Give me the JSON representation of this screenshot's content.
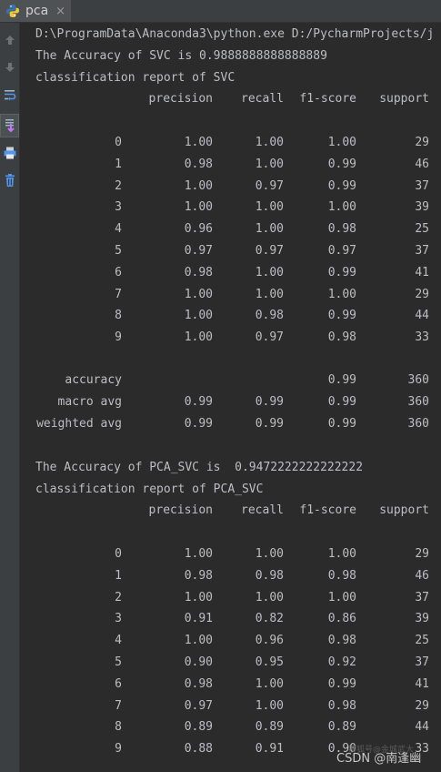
{
  "tab": {
    "title": "pca",
    "close": "×"
  },
  "sidebar": {
    "icons": [
      "up-arrow-icon",
      "down-arrow-icon",
      "soft-wrap-icon",
      "scroll-to-end-icon",
      "print-icon",
      "trash-icon"
    ]
  },
  "console": {
    "command_line": "D:\\ProgramData\\Anaconda3\\python.exe D:/PycharmProjects/j",
    "svc_accuracy_line": "The Accuracy of SVC is 0.9888888888888889",
    "svc_report_title": "classification report of SVC",
    "pca_accuracy_line": "The Accuracy of PCA_SVC is  0.9472222222222222",
    "pca_report_title": "classification report of PCA_SVC"
  },
  "report_columns": [
    "precision",
    "recall",
    "f1-score",
    "support"
  ],
  "svc_report": {
    "rows": [
      {
        "label": "0",
        "precision": "1.00",
        "recall": "1.00",
        "f1": "1.00",
        "support": "29"
      },
      {
        "label": "1",
        "precision": "0.98",
        "recall": "1.00",
        "f1": "0.99",
        "support": "46"
      },
      {
        "label": "2",
        "precision": "1.00",
        "recall": "0.97",
        "f1": "0.99",
        "support": "37"
      },
      {
        "label": "3",
        "precision": "1.00",
        "recall": "1.00",
        "f1": "1.00",
        "support": "39"
      },
      {
        "label": "4",
        "precision": "0.96",
        "recall": "1.00",
        "f1": "0.98",
        "support": "25"
      },
      {
        "label": "5",
        "precision": "0.97",
        "recall": "0.97",
        "f1": "0.97",
        "support": "37"
      },
      {
        "label": "6",
        "precision": "0.98",
        "recall": "1.00",
        "f1": "0.99",
        "support": "41"
      },
      {
        "label": "7",
        "precision": "1.00",
        "recall": "1.00",
        "f1": "1.00",
        "support": "29"
      },
      {
        "label": "8",
        "precision": "1.00",
        "recall": "0.98",
        "f1": "0.99",
        "support": "44"
      },
      {
        "label": "9",
        "precision": "1.00",
        "recall": "0.97",
        "f1": "0.98",
        "support": "33"
      }
    ],
    "summary": [
      {
        "label": "accuracy",
        "precision": "",
        "recall": "",
        "f1": "0.99",
        "support": "360"
      },
      {
        "label": "macro avg",
        "precision": "0.99",
        "recall": "0.99",
        "f1": "0.99",
        "support": "360"
      },
      {
        "label": "weighted avg",
        "precision": "0.99",
        "recall": "0.99",
        "f1": "0.99",
        "support": "360"
      }
    ]
  },
  "pca_report": {
    "rows": [
      {
        "label": "0",
        "precision": "1.00",
        "recall": "1.00",
        "f1": "1.00",
        "support": "29"
      },
      {
        "label": "1",
        "precision": "0.98",
        "recall": "0.98",
        "f1": "0.98",
        "support": "46"
      },
      {
        "label": "2",
        "precision": "1.00",
        "recall": "1.00",
        "f1": "1.00",
        "support": "37"
      },
      {
        "label": "3",
        "precision": "0.91",
        "recall": "0.82",
        "f1": "0.86",
        "support": "39"
      },
      {
        "label": "4",
        "precision": "1.00",
        "recall": "0.96",
        "f1": "0.98",
        "support": "25"
      },
      {
        "label": "5",
        "precision": "0.90",
        "recall": "0.95",
        "f1": "0.92",
        "support": "37"
      },
      {
        "label": "6",
        "precision": "0.98",
        "recall": "1.00",
        "f1": "0.99",
        "support": "41"
      },
      {
        "label": "7",
        "precision": "0.97",
        "recall": "1.00",
        "f1": "0.98",
        "support": "29"
      },
      {
        "label": "8",
        "precision": "0.89",
        "recall": "0.89",
        "f1": "0.89",
        "support": "44"
      },
      {
        "label": "9",
        "precision": "0.88",
        "recall": "0.91",
        "f1": "0.90",
        "support": "33"
      }
    ]
  },
  "watermark": {
    "text": "CSDN @南逢幽",
    "faint": "搜狐号@金城武大"
  },
  "colors": {
    "background": "#2b2b2b",
    "text": "#bcbec4",
    "panel": "#3c3f41",
    "python_blue": "#3775a9",
    "python_yellow": "#f5c73b"
  }
}
